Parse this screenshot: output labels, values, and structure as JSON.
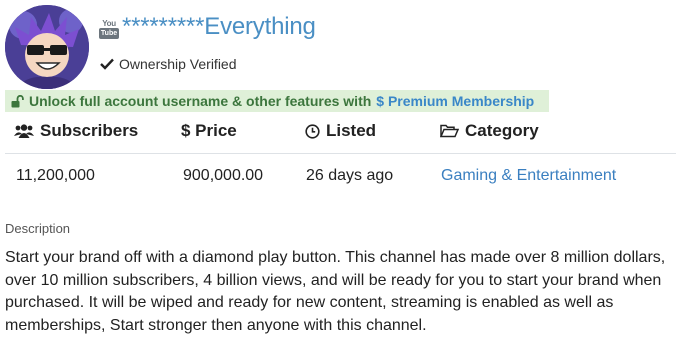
{
  "listing": {
    "platform": "YouTube",
    "logo_top": "You",
    "logo_bottom": "Tube",
    "channel_name": "*********Everything",
    "verified_text": "Ownership Verified"
  },
  "banner": {
    "text": "Unlock full account username & other features with",
    "link_text": "$ Premium Membership"
  },
  "stats": {
    "headers": {
      "subscribers": "Subscribers",
      "price": "$ Price",
      "listed": "Listed",
      "category": "Category"
    },
    "values": {
      "subscribers": "11,200,000",
      "price": "900,000.00",
      "listed": "26 days ago",
      "category": "Gaming & Entertainment"
    }
  },
  "description": {
    "label": "Description",
    "text": "Start your brand off with a diamond play button. This channel has made over 8 million dollars, over 10 million subscribers, 4 billion views, and will be ready for you to start your brand when purchased. It will be wiped and ready for new content, streaming is enabled as well as memberships, Start stronger then anyone with this channel."
  },
  "colors": {
    "link": "#3a7fc0",
    "channel_name": "#4a8fc4",
    "banner_bg": "#dff0d8",
    "banner_text": "#3c763d"
  }
}
